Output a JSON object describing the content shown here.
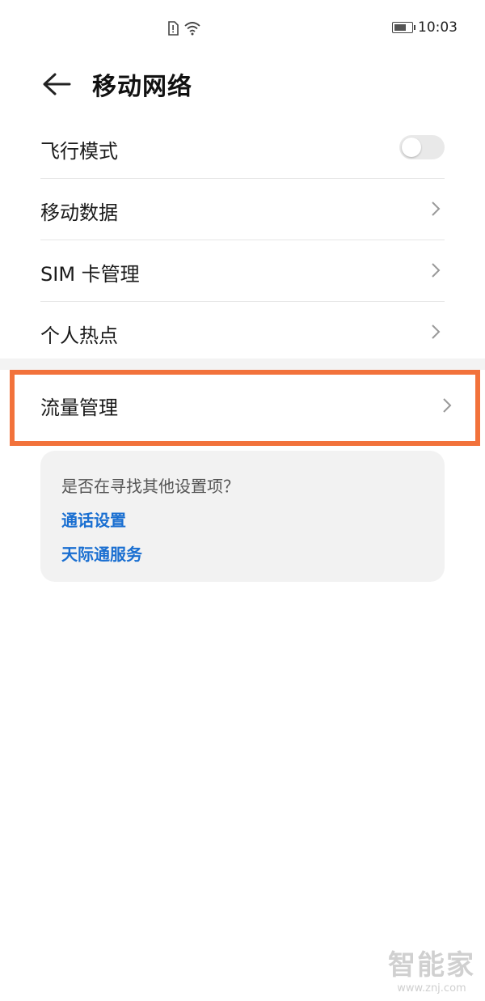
{
  "status_bar": {
    "time": "10:03"
  },
  "header": {
    "title": "移动网络"
  },
  "settings": {
    "airplane_mode": {
      "label": "飞行模式",
      "enabled": false
    },
    "mobile_data": {
      "label": "移动数据"
    },
    "sim_management": {
      "label": "SIM 卡管理"
    },
    "personal_hotspot": {
      "label": "个人热点"
    },
    "data_usage": {
      "label": "流量管理"
    }
  },
  "suggestions": {
    "question": "是否在寻找其他设置项？",
    "links": [
      "通话设置",
      "天际通服务"
    ]
  },
  "highlight_color": "#f2723b",
  "link_color": "#1a6fd1",
  "watermark": {
    "brand": "智能家",
    "url": "www.znj.com"
  }
}
